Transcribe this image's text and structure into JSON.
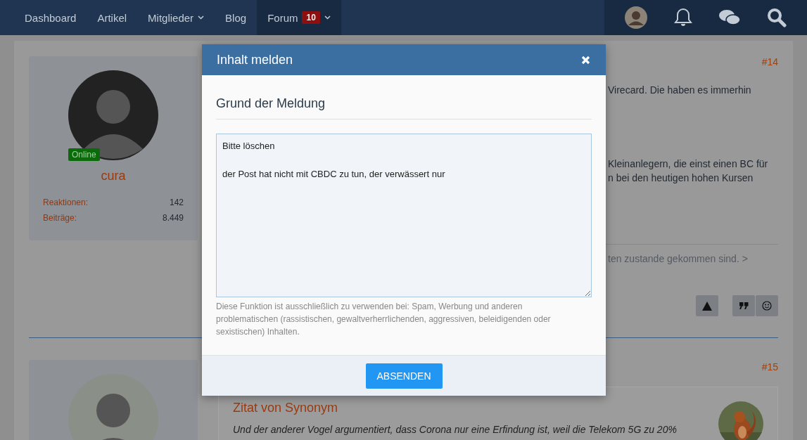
{
  "nav": {
    "items": [
      {
        "label": "Dashboard",
        "selected": false,
        "has_dropdown": false
      },
      {
        "label": "Artikel",
        "selected": false,
        "has_dropdown": false
      },
      {
        "label": "Mitglieder",
        "selected": false,
        "has_dropdown": true
      },
      {
        "label": "Blog",
        "selected": false,
        "has_dropdown": false
      },
      {
        "label": "Forum",
        "selected": true,
        "has_dropdown": true,
        "badge": "10"
      }
    ]
  },
  "posts": [
    {
      "number": "#14",
      "author": {
        "name": "cura",
        "status": "Online",
        "stats": [
          {
            "label": "Reaktionen:",
            "value": "142"
          },
          {
            "label": "Beiträge:",
            "value": "8.449"
          }
        ]
      },
      "paragraphs": [
        [
          "Virecard. Die haben es immerhin"
        ],
        [
          "Kleinanlegern, die einst einen BC für",
          "n bei den heutigen hohen Kursen"
        ]
      ],
      "signature": "ten zustande gekommen sind. >"
    },
    {
      "number": "#15",
      "quote": {
        "title": "Zitat von Synonym",
        "text": "Und der anderer Vogel argumentiert, dass Corona nur eine Erfindung ist, weil die Telekom 5G zu 20%"
      }
    }
  ],
  "modal": {
    "title": "Inhalt melden",
    "section_title": "Grund der Meldung",
    "reason": "Bitte löschen\n\nder Post hat nicht mit CBDC zu tun, der verwässert nur",
    "help_text": "Diese Funktion ist ausschließlich zu verwenden bei: Spam, Werbung und anderen problematischen (rassistischen, gewaltverherrlichenden, aggressiven, beleidigenden oder sexistischen) Inhalten.",
    "submit_label": "ABSENDEN"
  }
}
